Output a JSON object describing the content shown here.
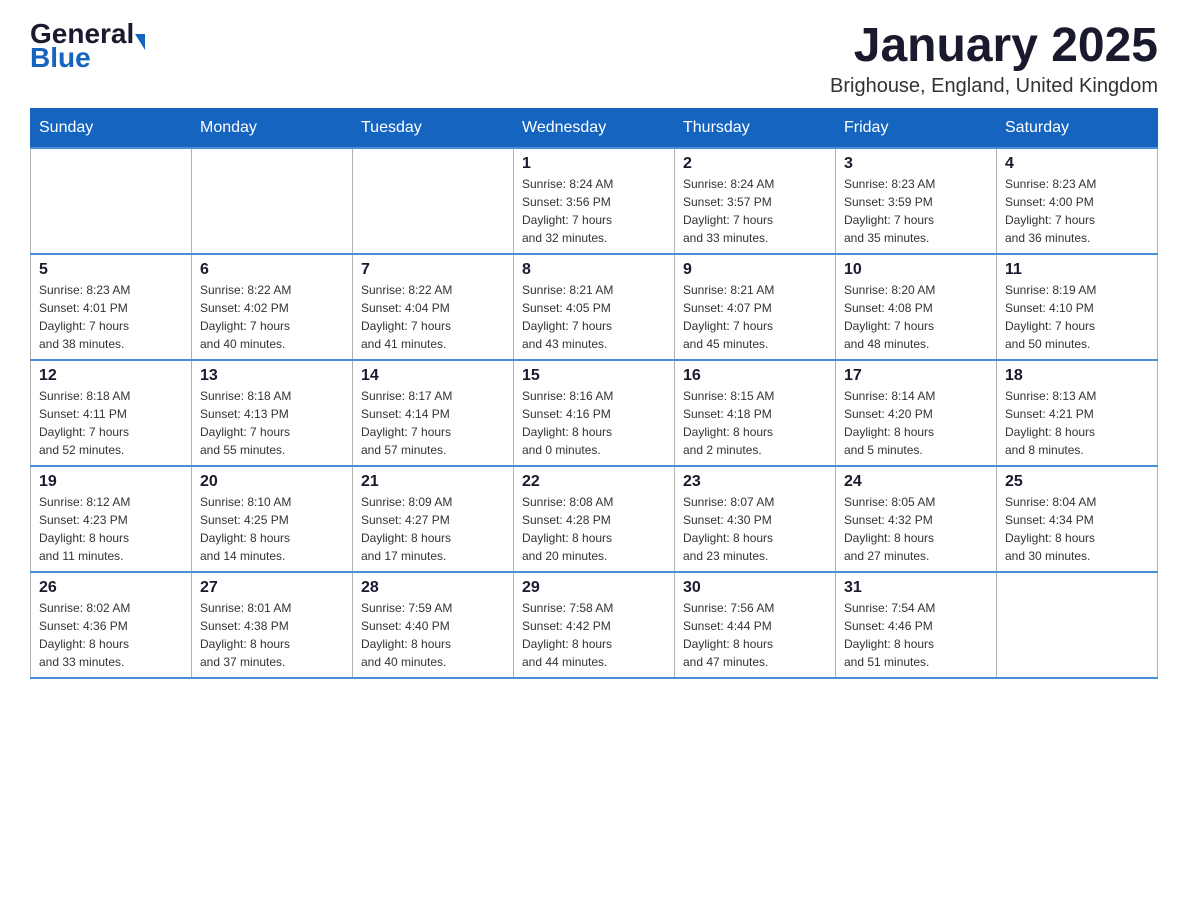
{
  "logo": {
    "general_text": "General",
    "blue_text": "Blue"
  },
  "header": {
    "month_title": "January 2025",
    "location": "Brighouse, England, United Kingdom"
  },
  "weekdays": [
    "Sunday",
    "Monday",
    "Tuesday",
    "Wednesday",
    "Thursday",
    "Friday",
    "Saturday"
  ],
  "weeks": [
    [
      {
        "day": "",
        "info": ""
      },
      {
        "day": "",
        "info": ""
      },
      {
        "day": "",
        "info": ""
      },
      {
        "day": "1",
        "info": "Sunrise: 8:24 AM\nSunset: 3:56 PM\nDaylight: 7 hours\nand 32 minutes."
      },
      {
        "day": "2",
        "info": "Sunrise: 8:24 AM\nSunset: 3:57 PM\nDaylight: 7 hours\nand 33 minutes."
      },
      {
        "day": "3",
        "info": "Sunrise: 8:23 AM\nSunset: 3:59 PM\nDaylight: 7 hours\nand 35 minutes."
      },
      {
        "day": "4",
        "info": "Sunrise: 8:23 AM\nSunset: 4:00 PM\nDaylight: 7 hours\nand 36 minutes."
      }
    ],
    [
      {
        "day": "5",
        "info": "Sunrise: 8:23 AM\nSunset: 4:01 PM\nDaylight: 7 hours\nand 38 minutes."
      },
      {
        "day": "6",
        "info": "Sunrise: 8:22 AM\nSunset: 4:02 PM\nDaylight: 7 hours\nand 40 minutes."
      },
      {
        "day": "7",
        "info": "Sunrise: 8:22 AM\nSunset: 4:04 PM\nDaylight: 7 hours\nand 41 minutes."
      },
      {
        "day": "8",
        "info": "Sunrise: 8:21 AM\nSunset: 4:05 PM\nDaylight: 7 hours\nand 43 minutes."
      },
      {
        "day": "9",
        "info": "Sunrise: 8:21 AM\nSunset: 4:07 PM\nDaylight: 7 hours\nand 45 minutes."
      },
      {
        "day": "10",
        "info": "Sunrise: 8:20 AM\nSunset: 4:08 PM\nDaylight: 7 hours\nand 48 minutes."
      },
      {
        "day": "11",
        "info": "Sunrise: 8:19 AM\nSunset: 4:10 PM\nDaylight: 7 hours\nand 50 minutes."
      }
    ],
    [
      {
        "day": "12",
        "info": "Sunrise: 8:18 AM\nSunset: 4:11 PM\nDaylight: 7 hours\nand 52 minutes."
      },
      {
        "day": "13",
        "info": "Sunrise: 8:18 AM\nSunset: 4:13 PM\nDaylight: 7 hours\nand 55 minutes."
      },
      {
        "day": "14",
        "info": "Sunrise: 8:17 AM\nSunset: 4:14 PM\nDaylight: 7 hours\nand 57 minutes."
      },
      {
        "day": "15",
        "info": "Sunrise: 8:16 AM\nSunset: 4:16 PM\nDaylight: 8 hours\nand 0 minutes."
      },
      {
        "day": "16",
        "info": "Sunrise: 8:15 AM\nSunset: 4:18 PM\nDaylight: 8 hours\nand 2 minutes."
      },
      {
        "day": "17",
        "info": "Sunrise: 8:14 AM\nSunset: 4:20 PM\nDaylight: 8 hours\nand 5 minutes."
      },
      {
        "day": "18",
        "info": "Sunrise: 8:13 AM\nSunset: 4:21 PM\nDaylight: 8 hours\nand 8 minutes."
      }
    ],
    [
      {
        "day": "19",
        "info": "Sunrise: 8:12 AM\nSunset: 4:23 PM\nDaylight: 8 hours\nand 11 minutes."
      },
      {
        "day": "20",
        "info": "Sunrise: 8:10 AM\nSunset: 4:25 PM\nDaylight: 8 hours\nand 14 minutes."
      },
      {
        "day": "21",
        "info": "Sunrise: 8:09 AM\nSunset: 4:27 PM\nDaylight: 8 hours\nand 17 minutes."
      },
      {
        "day": "22",
        "info": "Sunrise: 8:08 AM\nSunset: 4:28 PM\nDaylight: 8 hours\nand 20 minutes."
      },
      {
        "day": "23",
        "info": "Sunrise: 8:07 AM\nSunset: 4:30 PM\nDaylight: 8 hours\nand 23 minutes."
      },
      {
        "day": "24",
        "info": "Sunrise: 8:05 AM\nSunset: 4:32 PM\nDaylight: 8 hours\nand 27 minutes."
      },
      {
        "day": "25",
        "info": "Sunrise: 8:04 AM\nSunset: 4:34 PM\nDaylight: 8 hours\nand 30 minutes."
      }
    ],
    [
      {
        "day": "26",
        "info": "Sunrise: 8:02 AM\nSunset: 4:36 PM\nDaylight: 8 hours\nand 33 minutes."
      },
      {
        "day": "27",
        "info": "Sunrise: 8:01 AM\nSunset: 4:38 PM\nDaylight: 8 hours\nand 37 minutes."
      },
      {
        "day": "28",
        "info": "Sunrise: 7:59 AM\nSunset: 4:40 PM\nDaylight: 8 hours\nand 40 minutes."
      },
      {
        "day": "29",
        "info": "Sunrise: 7:58 AM\nSunset: 4:42 PM\nDaylight: 8 hours\nand 44 minutes."
      },
      {
        "day": "30",
        "info": "Sunrise: 7:56 AM\nSunset: 4:44 PM\nDaylight: 8 hours\nand 47 minutes."
      },
      {
        "day": "31",
        "info": "Sunrise: 7:54 AM\nSunset: 4:46 PM\nDaylight: 8 hours\nand 51 minutes."
      },
      {
        "day": "",
        "info": ""
      }
    ]
  ]
}
